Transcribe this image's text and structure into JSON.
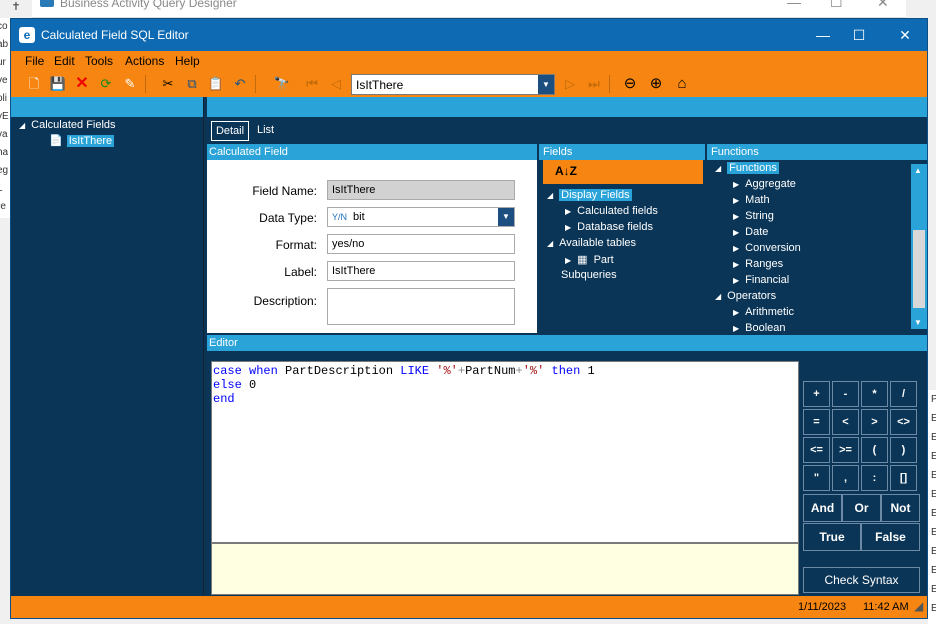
{
  "background_window": {
    "title": "Business Activity Query Designer",
    "left_fragments": [
      "co",
      "ab",
      "ur",
      "ve",
      "oli",
      "yE",
      "va",
      "ha",
      "eg",
      "L",
      "re"
    ],
    "right_fragments": [
      "P",
      "E",
      "E",
      "E",
      "E",
      "E",
      "E",
      "E",
      "E",
      "E",
      "E",
      "E"
    ]
  },
  "window": {
    "title": "Calculated Field SQL Editor"
  },
  "menu": [
    "File",
    "Edit",
    "Tools",
    "Actions",
    "Help"
  ],
  "toolbar": {
    "combo_value": "IsItThere"
  },
  "tree": {
    "root": "Calculated Fields",
    "child": "IsItThere"
  },
  "tabs": {
    "detail": "Detail",
    "list": "List"
  },
  "calculated_field": {
    "header": "Calculated Field",
    "field_name_label": "Field Name:",
    "field_name_value": "IsItThere",
    "data_type_label": "Data Type:",
    "data_type_prefix": "Y/N",
    "data_type_value": "bit",
    "format_label": "Format:",
    "format_value": "yes/no",
    "label_label": "Label:",
    "label_value": "IsItThere",
    "description_label": "Description:",
    "description_value": ""
  },
  "fields": {
    "header": "Fields",
    "sort_icon_text": "A↓Z",
    "display_fields": "Display Fields",
    "calculated_fields": "Calculated fields",
    "database_fields": "Database fields",
    "available_tables": "Available tables",
    "part": "Part",
    "subqueries": "Subqueries"
  },
  "functions": {
    "header": "Functions",
    "root": "Functions",
    "items": [
      "Aggregate",
      "Math",
      "String",
      "Date",
      "Conversion",
      "Ranges",
      "Financial"
    ],
    "operators": "Operators",
    "operator_items": [
      "Arithmetic",
      "Boolean"
    ]
  },
  "editor": {
    "header": "Editor",
    "line1": {
      "kw1": "case",
      "kw2": "when",
      "ident": " PartDescription ",
      "kw3": "LIKE",
      "sp": " ",
      "s1": "'%'",
      "op1": "+",
      "ident2": "PartNum",
      "op2": "+",
      "s2": "'%'",
      "sp2": " ",
      "kw4": "then",
      "num": " 1"
    },
    "line2": {
      "kw": "else",
      "num": " 0"
    },
    "line3": {
      "kw": "end"
    }
  },
  "keypad": {
    "row1": [
      "+",
      "-",
      "*",
      "/"
    ],
    "row2": [
      "=",
      "<",
      ">",
      "<>"
    ],
    "row3": [
      "<=",
      ">=",
      "(",
      ")"
    ],
    "row4": [
      "\"",
      ",",
      ":",
      "[]"
    ],
    "row5": [
      "And",
      "Or",
      "Not"
    ],
    "row6": [
      "True",
      "False"
    ],
    "check": "Check Syntax"
  },
  "status": {
    "date": "1/11/2023",
    "time": "11:42 AM"
  }
}
